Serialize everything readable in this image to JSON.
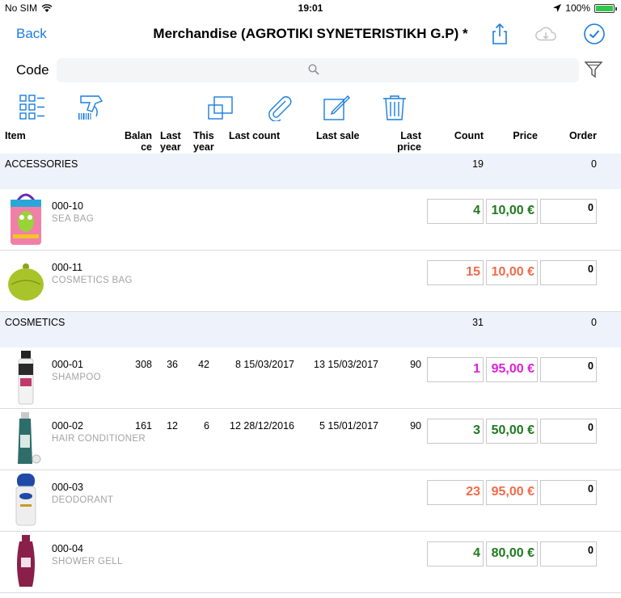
{
  "status": {
    "carrier": "No SIM",
    "time": "19:01",
    "battery": "100%"
  },
  "nav": {
    "back_label": "Back",
    "title": "Merchandise (AGROTIKI SYNETERISTIKH G.P) *"
  },
  "search": {
    "label": "Code",
    "placeholder": ""
  },
  "columns": {
    "item": "Item",
    "balance_1": "Balan",
    "balance_2": "ce",
    "last_year_1": "Last",
    "last_year_2": "year",
    "this_year_1": "This",
    "this_year_2": "year",
    "last_count": "Last count",
    "last_sale": "Last sale",
    "last_price_1": "Last",
    "last_price_2": "price",
    "count": "Count",
    "price": "Price",
    "order": "Order"
  },
  "sections": [
    {
      "name": "ACCESSORIES",
      "count": "19",
      "order": "0"
    },
    {
      "name": "COSMETICS",
      "count": "31",
      "order": "0"
    }
  ],
  "rows": [
    {
      "code": "000-10",
      "name": "SEA BAG",
      "balance": "",
      "last_year": "",
      "this_year": "",
      "last_count": "",
      "last_sale": "",
      "last_price": "",
      "count": "4",
      "price": "10,00 €",
      "order": "0",
      "count_color": "#1e7a1e",
      "price_color": "#1e7a1e"
    },
    {
      "code": "000-11",
      "name": "COSMETICS BAG",
      "balance": "",
      "last_year": "",
      "this_year": "",
      "last_count": "",
      "last_sale": "",
      "last_price": "",
      "count": "15",
      "price": "10,00 €",
      "order": "0",
      "count_color": "#f06a4a",
      "price_color": "#f06a4a"
    },
    {
      "code": "000-01",
      "name": "SHAMPOO",
      "balance": "308",
      "last_year": "36",
      "this_year": "42",
      "last_count": "8 15/03/2017",
      "last_sale": "13 15/03/2017",
      "last_price": "90",
      "count": "1",
      "price": "95,00 €",
      "order": "0",
      "count_color": "#e020d8",
      "price_color": "#e020d8"
    },
    {
      "code": "000-02",
      "name": "HAIR CONDITIONER",
      "balance": "161",
      "last_year": "12",
      "this_year": "6",
      "last_count": "12 28/12/2016",
      "last_sale": "5 15/01/2017",
      "last_price": "90",
      "count": "3",
      "price": "50,00 €",
      "order": "0",
      "count_color": "#1e7a1e",
      "price_color": "#1e7a1e"
    },
    {
      "code": "000-03",
      "name": "DEODORANT",
      "balance": "",
      "last_year": "",
      "this_year": "",
      "last_count": "",
      "last_sale": "",
      "last_price": "",
      "count": "23",
      "price": "95,00 €",
      "order": "0",
      "count_color": "#f06a4a",
      "price_color": "#f06a4a"
    },
    {
      "code": "000-04",
      "name": "SHOWER GELL",
      "balance": "",
      "last_year": "",
      "this_year": "",
      "last_count": "",
      "last_sale": "",
      "last_price": "",
      "count": "4",
      "price": "80,00 €",
      "order": "0",
      "count_color": "#1e7a1e",
      "price_color": "#1e7a1e"
    }
  ],
  "icons": {
    "wifi": "wifi-icon",
    "location": "location-arrow-icon",
    "battery": "battery-icon",
    "share": "share-icon",
    "cloud": "cloud-download-icon",
    "done": "checkmark-circle-icon",
    "search": "search-icon",
    "filter": "filter-funnel-icon",
    "tools": [
      "grid-list-icon",
      "barcode-scanner-icon",
      "copy-icon",
      "paperclip-icon",
      "edit-icon",
      "trash-icon"
    ]
  },
  "colors": {
    "accent": "#1a7ce0",
    "section_bg": "#eef2fb"
  }
}
